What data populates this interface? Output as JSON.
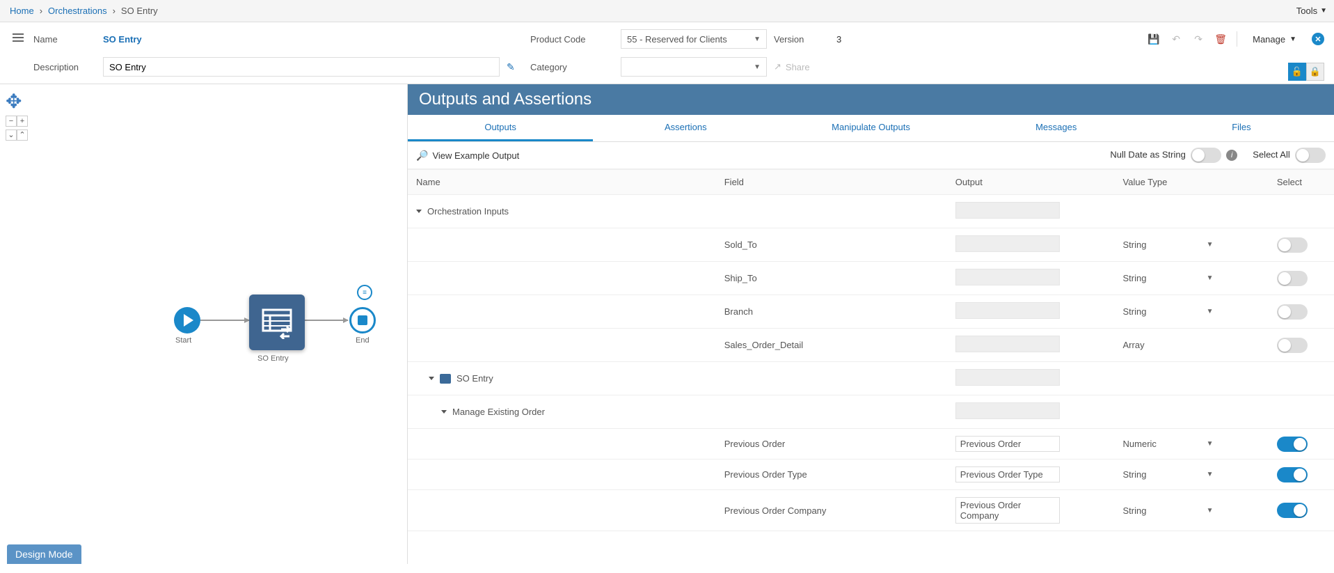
{
  "breadcrumb": {
    "home": "Home",
    "orchestrations": "Orchestrations",
    "current": "SO Entry",
    "tools": "Tools"
  },
  "header": {
    "name_label": "Name",
    "name_value": "SO Entry",
    "desc_label": "Description",
    "desc_value": "SO Entry",
    "product_code_label": "Product Code",
    "product_code_value": "55 - Reserved for Clients",
    "version_label": "Version",
    "version_value": "3",
    "category_label": "Category",
    "category_value": "",
    "share_label": "Share",
    "manage_label": "Manage"
  },
  "flow": {
    "start": "Start",
    "task": "SO Entry",
    "end": "End"
  },
  "design_mode": "Design Mode",
  "panel": {
    "title": "Outputs and Assertions",
    "tabs": {
      "outputs": "Outputs",
      "assertions": "Assertions",
      "manipulate": "Manipulate Outputs",
      "messages": "Messages",
      "files": "Files"
    },
    "view_example": "View Example Output",
    "null_date": "Null Date as String",
    "select_all": "Select All",
    "columns": {
      "name": "Name",
      "field": "Field",
      "output": "Output",
      "value_type": "Value Type",
      "select": "Select"
    },
    "rows": [
      {
        "kind": "group",
        "indent": 0,
        "name": "Orchestration Inputs"
      },
      {
        "kind": "leaf",
        "field": "Sold_To",
        "output": null,
        "vt": "String",
        "select": false
      },
      {
        "kind": "leaf",
        "field": "Ship_To",
        "output": null,
        "vt": "String",
        "select": false
      },
      {
        "kind": "leaf",
        "field": "Branch",
        "output": null,
        "vt": "String",
        "select": false
      },
      {
        "kind": "leaf",
        "field": "Sales_Order_Detail",
        "output": null,
        "vt": "Array",
        "select": false,
        "no_vt_caret": true
      },
      {
        "kind": "group",
        "indent": 1,
        "icon": true,
        "name": "SO Entry"
      },
      {
        "kind": "group",
        "indent": 2,
        "name": "Manage Existing Order"
      },
      {
        "kind": "leaf",
        "field": "Previous Order",
        "output": "Previous Order",
        "vt": "Numeric",
        "select": true
      },
      {
        "kind": "leaf",
        "field": "Previous Order Type",
        "output": "Previous Order Type",
        "vt": "String",
        "select": true
      },
      {
        "kind": "leaf",
        "field": "Previous Order Company",
        "output": "Previous Order Company",
        "vt": "String",
        "select": true
      }
    ]
  }
}
